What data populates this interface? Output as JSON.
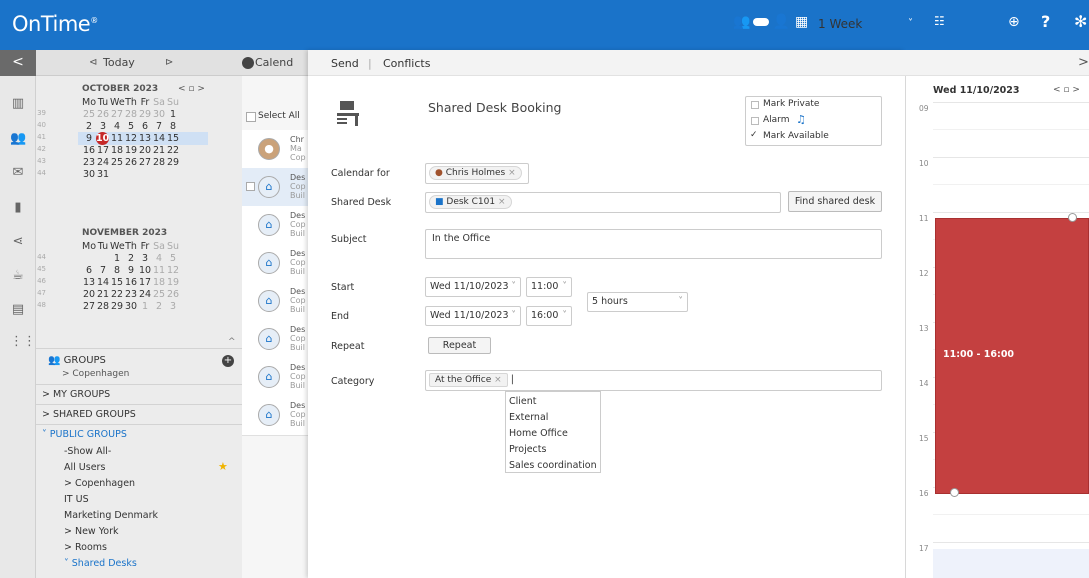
{
  "app": {
    "logo": "OnTime",
    "logo_mark": "®"
  },
  "topbar": {
    "view_label": "1 Week",
    "icons": [
      "people-toggle-icon",
      "calendar-week-icon",
      "chevron-down-icon",
      "list-icon",
      "search-person-icon",
      "help-icon",
      "gear-icon"
    ],
    "help": "?"
  },
  "nav": {
    "back": "<",
    "prev": "⊲",
    "today": "Today",
    "next": "⊳",
    "calendar_btn": "Calend"
  },
  "mini_cal": {
    "october": {
      "title": "OCTOBER 2023",
      "nav": "<  ▫  >",
      "weekdays": [
        "Mo",
        "Tu",
        "We",
        "Th",
        "Fr",
        "Sa",
        "Su"
      ],
      "rows": [
        {
          "wk": "39",
          "days": [
            "25",
            "26",
            "27",
            "28",
            "29",
            "30",
            "1"
          ]
        },
        {
          "wk": "40",
          "days": [
            "2",
            "3",
            "4",
            "5",
            "6",
            "7",
            "8"
          ]
        },
        {
          "wk": "41",
          "days": [
            "9",
            "10",
            "11",
            "12",
            "13",
            "14",
            "15"
          ]
        },
        {
          "wk": "42",
          "days": [
            "16",
            "17",
            "18",
            "19",
            "20",
            "21",
            "22"
          ]
        },
        {
          "wk": "43",
          "days": [
            "23",
            "24",
            "25",
            "26",
            "27",
            "28",
            "29"
          ]
        },
        {
          "wk": "44",
          "days": [
            "30",
            "31",
            "",
            "",
            "",
            "",
            ""
          ]
        }
      ]
    },
    "november": {
      "title": "NOVEMBER 2023",
      "weekdays": [
        "Mo",
        "Tu",
        "We",
        "Th",
        "Fr",
        "Sa",
        "Su"
      ],
      "rows": [
        {
          "wk": "44",
          "days": [
            "",
            "",
            "1",
            "2",
            "3",
            "4",
            "5"
          ]
        },
        {
          "wk": "45",
          "days": [
            "6",
            "7",
            "8",
            "9",
            "10",
            "11",
            "12"
          ]
        },
        {
          "wk": "46",
          "days": [
            "13",
            "14",
            "15",
            "16",
            "17",
            "18",
            "19"
          ]
        },
        {
          "wk": "47",
          "days": [
            "20",
            "21",
            "22",
            "23",
            "24",
            "25",
            "26"
          ]
        },
        {
          "wk": "48",
          "days": [
            "27",
            "28",
            "29",
            "30",
            "1",
            "2",
            "3"
          ]
        }
      ]
    }
  },
  "groups": {
    "title": "GROUPS",
    "sub": "> Copenhagen",
    "my": "> MY GROUPS",
    "shared": "> SHARED GROUPS",
    "public": "˅ PUBLIC GROUPS",
    "items": [
      "-Show All-",
      "All Users",
      "> Copenhagen",
      "IT US",
      "Marketing Denmark",
      "> New York",
      "> Rooms",
      "˅ Shared Desks"
    ]
  },
  "people": {
    "select_all": "Select All",
    "cards": [
      {
        "l1": "Chr",
        "l2": "Ma",
        "l3": "Cop"
      },
      {
        "l1": "Des",
        "l2": "Cop",
        "l3": "Buil"
      },
      {
        "l1": "Des",
        "l2": "Cop",
        "l3": "Buil"
      },
      {
        "l1": "Des",
        "l2": "Cop",
        "l3": "Buil"
      },
      {
        "l1": "Des",
        "l2": "Cop",
        "l3": "Buil"
      },
      {
        "l1": "Des",
        "l2": "Cop",
        "l3": "Buil"
      },
      {
        "l1": "Des",
        "l2": "Cop",
        "l3": "Buil"
      },
      {
        "l1": "Des",
        "l2": "Cop",
        "l3": "Buil"
      }
    ]
  },
  "modal": {
    "send": "Send",
    "sep": "|",
    "conflicts": "Conflicts",
    "close": ">",
    "title": "Shared Desk Booking",
    "options": {
      "private": "Mark Private",
      "alarm": "Alarm",
      "available": "Mark Available"
    },
    "labels": {
      "calendar_for": "Calendar for",
      "shared_desk": "Shared Desk",
      "subject": "Subject",
      "start": "Start",
      "end": "End",
      "repeat": "Repeat",
      "category": "Category"
    },
    "calendar_for": "Chris Holmes",
    "shared_desk": "Desk C101",
    "find_desk": "Find shared desk",
    "subject": "In the Office",
    "start_date": "Wed 11/10/2023",
    "start_time": "11:00",
    "end_date": "Wed 11/10/2023",
    "end_time": "16:00",
    "duration": "5 hours",
    "repeat_btn": "Repeat",
    "category_chip": "At the Office",
    "category_options": [
      "Client",
      "External",
      "Home Office",
      "Projects",
      "Sales coordination"
    ]
  },
  "right_cal": {
    "date": "Wed 11/10/2023",
    "nav": "<  ▫  >",
    "hours": [
      "09",
      "10",
      "11",
      "12",
      "13",
      "14",
      "15",
      "16",
      "17"
    ],
    "event": "11:00 - 16:00",
    "event_color": "#c44040"
  }
}
